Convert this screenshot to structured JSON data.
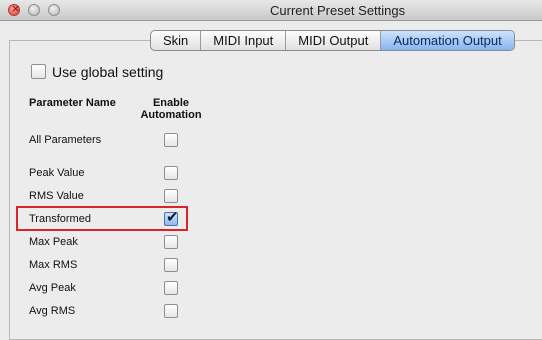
{
  "window": {
    "title": "Current Preset Settings"
  },
  "tabs": [
    {
      "label": "Skin",
      "selected": false
    },
    {
      "label": "MIDI Input",
      "selected": false
    },
    {
      "label": "MIDI Output",
      "selected": false
    },
    {
      "label": "Automation Output",
      "selected": true
    }
  ],
  "global_setting": {
    "label": "Use global setting",
    "checked": false
  },
  "table": {
    "col_name": "Parameter Name",
    "col_enable_line1": "Enable",
    "col_enable_line2": "Automation",
    "rows": [
      {
        "label": "All Parameters",
        "checked": false
      },
      {
        "label": "Peak Value",
        "checked": false
      },
      {
        "label": "RMS Value",
        "checked": false
      },
      {
        "label": "Transformed",
        "checked": true
      },
      {
        "label": "Max Peak",
        "checked": false
      },
      {
        "label": "Max RMS",
        "checked": false
      },
      {
        "label": "Avg Peak",
        "checked": false
      },
      {
        "label": "Avg RMS",
        "checked": false
      }
    ]
  },
  "highlight_color": "#d9232d",
  "accent_color": "#84b5f0"
}
